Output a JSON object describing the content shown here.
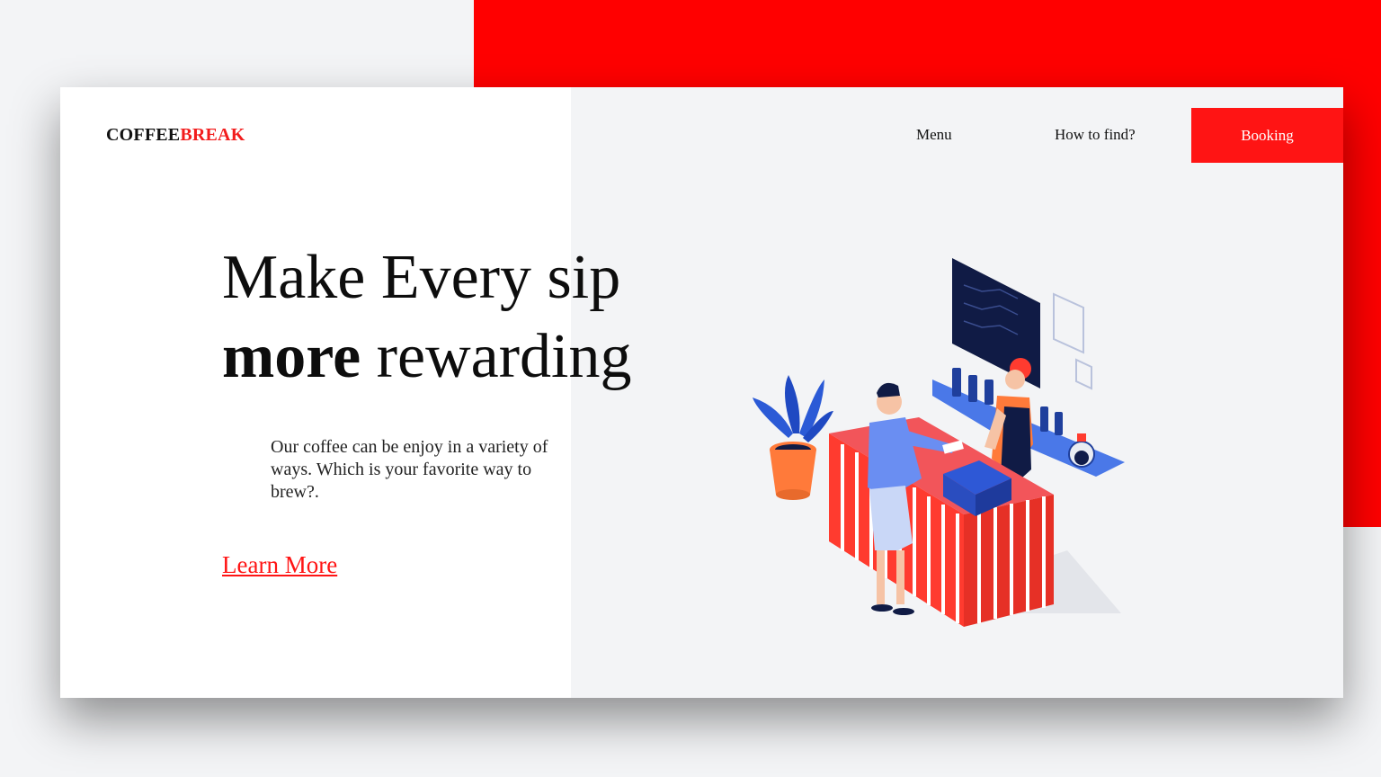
{
  "brand": {
    "part1": "COFFEE",
    "part2": "BREAK"
  },
  "nav": {
    "menu_label": "Menu",
    "find_label": "How to find?",
    "booking_label": "Booking"
  },
  "hero": {
    "line1": "Make Every sip",
    "line2_bold": "more",
    "line2_rest": " rewarding",
    "description": "Our coffee can be enjoy in a variety of ways. Which is your favorite way to brew?.",
    "cta_label": "Learn More"
  },
  "colors": {
    "accent": "#ff0000",
    "background": "#f3f4f6",
    "text": "#111111"
  },
  "illustration": {
    "icon": "barista-counter-illustration"
  }
}
